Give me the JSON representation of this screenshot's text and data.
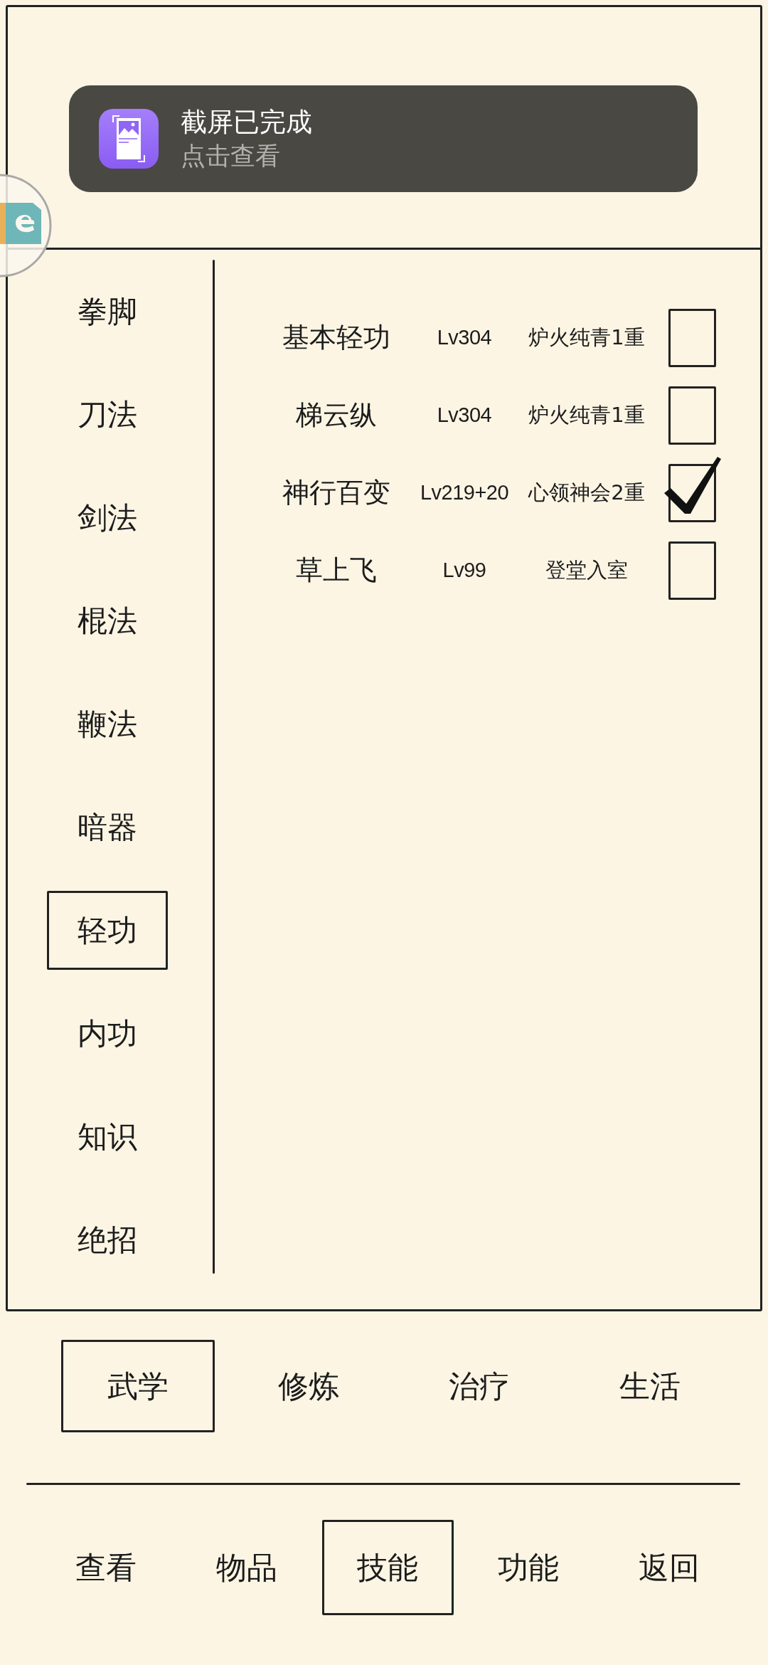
{
  "notification": {
    "title": "截屏已完成",
    "subtitle": "点击查看"
  },
  "categories": [
    {
      "label": "拳脚",
      "selected": false
    },
    {
      "label": "刀法",
      "selected": false
    },
    {
      "label": "剑法",
      "selected": false
    },
    {
      "label": "棍法",
      "selected": false
    },
    {
      "label": "鞭法",
      "selected": false
    },
    {
      "label": "暗器",
      "selected": false
    },
    {
      "label": "轻功",
      "selected": true
    },
    {
      "label": "内功",
      "selected": false
    },
    {
      "label": "知识",
      "selected": false
    },
    {
      "label": "绝招",
      "selected": false
    }
  ],
  "skills": [
    {
      "name": "基本轻功",
      "level_label": "Lv304",
      "realm": "炉火纯青1重",
      "checked": false
    },
    {
      "name": "梯云纵",
      "level_label": "Lv304",
      "realm": "炉火纯青1重",
      "checked": false
    },
    {
      "name": "神行百变",
      "level_label": "Lv219+20",
      "realm": "心领神会2重",
      "checked": true
    },
    {
      "name": "草上飞",
      "level_label": "Lv99",
      "realm": "登堂入室",
      "checked": false
    }
  ],
  "tabs": [
    {
      "label": "武学",
      "selected": true
    },
    {
      "label": "修炼",
      "selected": false
    },
    {
      "label": "治疗",
      "selected": false
    },
    {
      "label": "生活",
      "selected": false
    }
  ],
  "nav": [
    {
      "label": "查看",
      "selected": false
    },
    {
      "label": "物品",
      "selected": false
    },
    {
      "label": "技能",
      "selected": true
    },
    {
      "label": "功能",
      "selected": false
    },
    {
      "label": "返回",
      "selected": false
    }
  ]
}
